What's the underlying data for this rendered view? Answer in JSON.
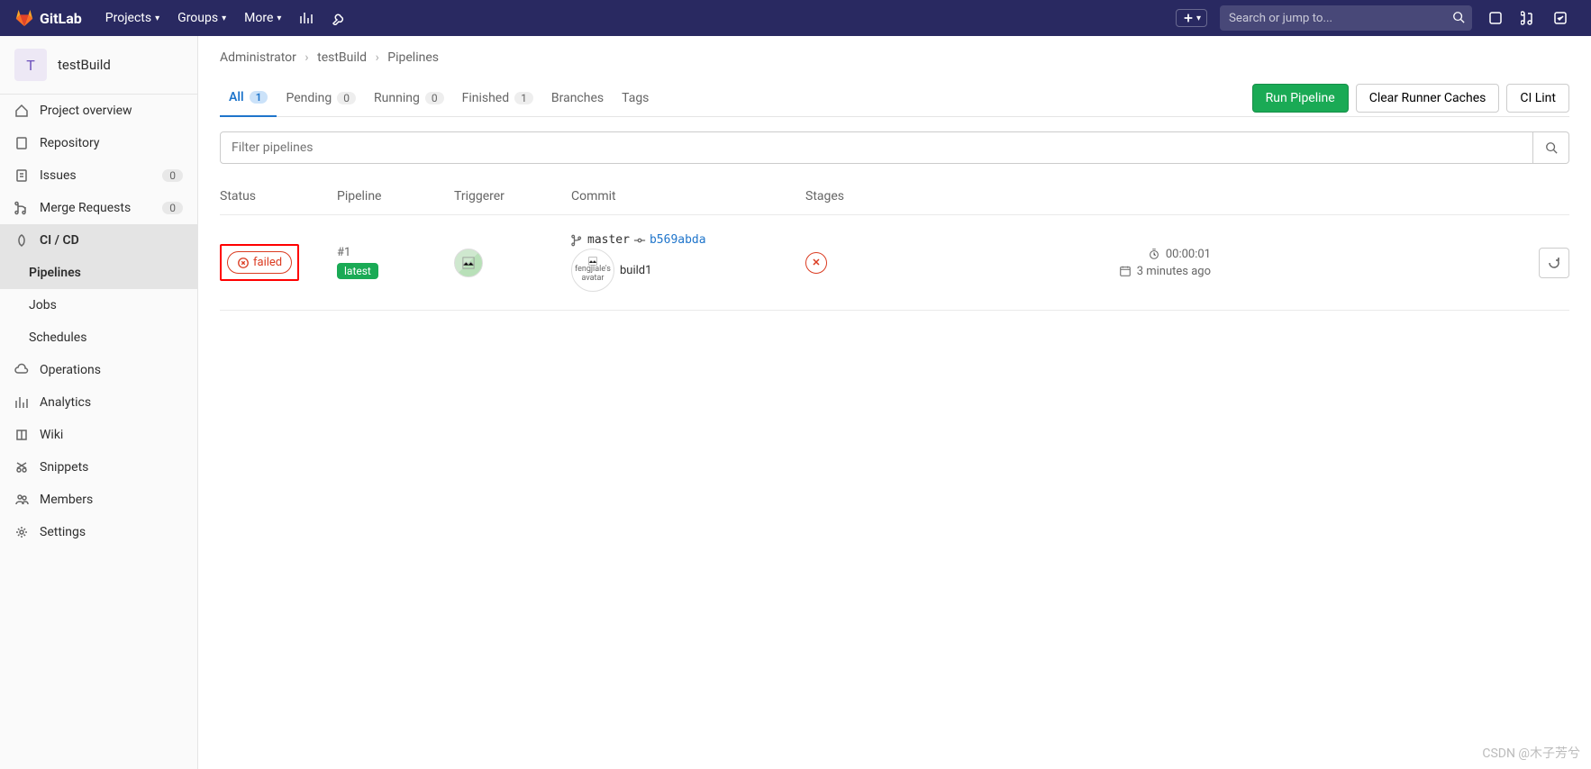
{
  "navbar": {
    "brand": "GitLab",
    "menu": {
      "projects": "Projects",
      "groups": "Groups",
      "more": "More"
    },
    "search_placeholder": "Search or jump to..."
  },
  "sidebar": {
    "project_initial": "T",
    "project_name": "testBuild",
    "items": {
      "overview": "Project overview",
      "repository": "Repository",
      "issues": "Issues",
      "issues_count": "0",
      "mrs": "Merge Requests",
      "mrs_count": "0",
      "cicd": "CI / CD",
      "pipelines": "Pipelines",
      "jobs": "Jobs",
      "schedules": "Schedules",
      "operations": "Operations",
      "analytics": "Analytics",
      "wiki": "Wiki",
      "snippets": "Snippets",
      "members": "Members",
      "settings": "Settings"
    }
  },
  "breadcrumb": {
    "owner": "Administrator",
    "project": "testBuild",
    "page": "Pipelines"
  },
  "tabs": {
    "all": {
      "label": "All",
      "count": "1"
    },
    "pending": {
      "label": "Pending",
      "count": "0"
    },
    "running": {
      "label": "Running",
      "count": "0"
    },
    "finished": {
      "label": "Finished",
      "count": "1"
    },
    "branches": {
      "label": "Branches"
    },
    "tags": {
      "label": "Tags"
    }
  },
  "actions": {
    "run": "Run Pipeline",
    "clear": "Clear Runner Caches",
    "lint": "CI Lint"
  },
  "filter": {
    "placeholder": "Filter pipelines"
  },
  "columns": {
    "status": "Status",
    "pipeline": "Pipeline",
    "triggerer": "Triggerer",
    "commit": "Commit",
    "stages": "Stages"
  },
  "row": {
    "status": "failed",
    "pipeline_num": "#1",
    "pipeline_flag": "latest",
    "branch": "master",
    "commit_sha": "b569abda",
    "avatar_text": "fengjiale's avatar",
    "commit_msg": "build1",
    "duration": "00:00:01",
    "timestamp": "3 minutes ago"
  },
  "watermark": "CSDN @木子芳兮"
}
